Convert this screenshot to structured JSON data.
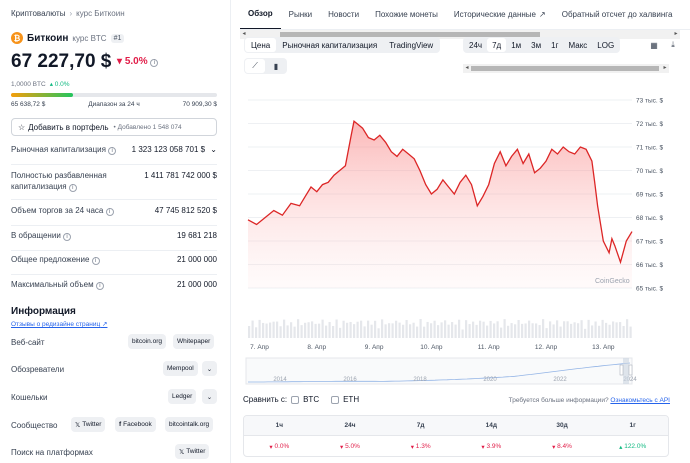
{
  "breadcrumb": {
    "root": "Криптовалюты",
    "current": "курс Биткоин"
  },
  "coin": {
    "logo": "₿",
    "name": "Биткоин",
    "sub": "курс BTC",
    "rank": "#1"
  },
  "price": {
    "value": "67 227,70 $",
    "change": "5.0%",
    "btc_value": "1,0000 BTC",
    "btc_change": "0.0%"
  },
  "range_24h": {
    "low": "65 638,72 $",
    "label": "Диапазон за 24 ч",
    "high": "70 909,30 $",
    "position_fraction": 0.3
  },
  "portfolio": {
    "button": "Добавить в портфель",
    "added": "Добавлено 1 548 074"
  },
  "stats": [
    {
      "label": "Рыночная капитализация",
      "value": "1 323 123 058 701 $",
      "info": true,
      "chevron": true
    },
    {
      "label": "Полностью разбавленная капитализация",
      "value": "1 411 781 742 000 $",
      "info": true
    },
    {
      "label": "Объем торгов за 24 часа",
      "value": "47 745 812 520 $",
      "info": true
    },
    {
      "label": "В обращении",
      "value": "19 681 218",
      "info": true
    },
    {
      "label": "Общее предложение",
      "value": "21 000 000",
      "info": true
    },
    {
      "label": "Максимальный объем",
      "value": "21 000 000",
      "info": true
    }
  ],
  "info_section": {
    "title": "Информация",
    "review_link": "Отзывы о редизайне страниц",
    "rows": [
      {
        "label": "Веб-сайт",
        "chips": [
          "bitcoin.org",
          "Whitepaper"
        ]
      },
      {
        "label": "Обозреватели",
        "chips": [
          "Mempool"
        ]
      },
      {
        "label": "Кошельки",
        "chips": [
          "Ledger"
        ]
      },
      {
        "label": "Сообщество",
        "chips": [
          "Twitter",
          "Facebook",
          "bitcointalk.org"
        ]
      },
      {
        "label": "Поиск на платформах",
        "chips": [
          "Twitter"
        ]
      }
    ]
  },
  "tabs": [
    "Обзор",
    "Рынки",
    "Новости",
    "Похожие монеты",
    "Исторические данные",
    "Обратный отсчет до халвинга"
  ],
  "chart_controls": {
    "metrics": [
      "Цена",
      "Рыночная капитализация",
      "TradingView"
    ],
    "ranges": [
      "24ч",
      "7д",
      "1м",
      "3м",
      "1г",
      "Макс",
      "LOG"
    ],
    "active_range": "7д",
    "active_metric": "Цена"
  },
  "watermark": "CoinGecko",
  "chart_data": {
    "type": "area",
    "x_ticks": [
      "7. Апр",
      "8. Апр",
      "9. Апр",
      "10. Апр",
      "11. Апр",
      "12. Апр",
      "13. Апр"
    ],
    "y_ticks": [
      "65 тыс. $",
      "66 тыс. $",
      "67 тыс. $",
      "68 тыс. $",
      "69 тыс. $",
      "70 тыс. $",
      "71 тыс. $",
      "72 тыс. $",
      "73 тыс. $"
    ],
    "ylim": [
      65,
      73
    ],
    "x": [
      0,
      0.15,
      0.3,
      0.45,
      0.6,
      0.75,
      0.9,
      1.0,
      1.1,
      1.2,
      1.3,
      1.4,
      1.5,
      1.6,
      1.7,
      1.8,
      1.85,
      1.9,
      2.0,
      2.1,
      2.2,
      2.3,
      2.4,
      2.5,
      2.6,
      2.7,
      2.8,
      2.9,
      3.0,
      3.1,
      3.2,
      3.3,
      3.4,
      3.5,
      3.6,
      3.7,
      3.8,
      3.9,
      4.0,
      4.1,
      4.2,
      4.3,
      4.4,
      4.5,
      4.6,
      4.7,
      4.8,
      4.9,
      5.0,
      5.1,
      5.2,
      5.3,
      5.4,
      5.5,
      5.6,
      5.7,
      5.8,
      5.9,
      6.0,
      6.05,
      6.1,
      6.2,
      6.3,
      6.35,
      6.4,
      6.5,
      6.6,
      6.7
    ],
    "y": [
      67.9,
      67.7,
      68.0,
      68.3,
      68.1,
      68.6,
      68.5,
      68.9,
      69.3,
      69.1,
      69.4,
      69.5,
      69.8,
      70.0,
      70.2,
      71.5,
      72.1,
      72.0,
      71.8,
      71.4,
      71.3,
      71.5,
      71.2,
      70.8,
      70.6,
      70.9,
      70.7,
      70.5,
      70.0,
      69.4,
      69.0,
      69.2,
      69.6,
      69.3,
      69.0,
      69.5,
      69.8,
      69.4,
      68.5,
      68.9,
      69.4,
      70.3,
      70.8,
      70.2,
      70.6,
      70.9,
      70.3,
      70.7,
      69.9,
      70.1,
      70.4,
      70.9,
      70.7,
      71.0,
      70.8,
      70.7,
      71.0,
      70.9,
      70.4,
      69.5,
      68.5,
      67.0,
      66.5,
      67.1,
      66.8,
      66.1,
      67.0,
      67.4
    ],
    "nav_years": [
      "2014",
      "2016",
      "2018",
      "2020",
      "2022",
      "2024"
    ]
  },
  "compare": {
    "label": "Сравнить с:",
    "options": [
      "BTC",
      "ETH"
    ]
  },
  "more_info": {
    "text": "Требуется больше информации?",
    "link": "Ознакомьтесь с API"
  },
  "performance": {
    "headers": [
      "1ч",
      "24ч",
      "7д",
      "14д",
      "30д",
      "1г"
    ],
    "values": [
      "0.0%",
      "5.0%",
      "1.3%",
      "3.9%",
      "8.4%",
      "122.0%"
    ],
    "directions": [
      "down",
      "down",
      "down",
      "down",
      "down",
      "up"
    ]
  },
  "colors": {
    "negative": "#e11d48",
    "positive": "#10b981",
    "line": "#dc2626",
    "area": "#fca5a5"
  }
}
